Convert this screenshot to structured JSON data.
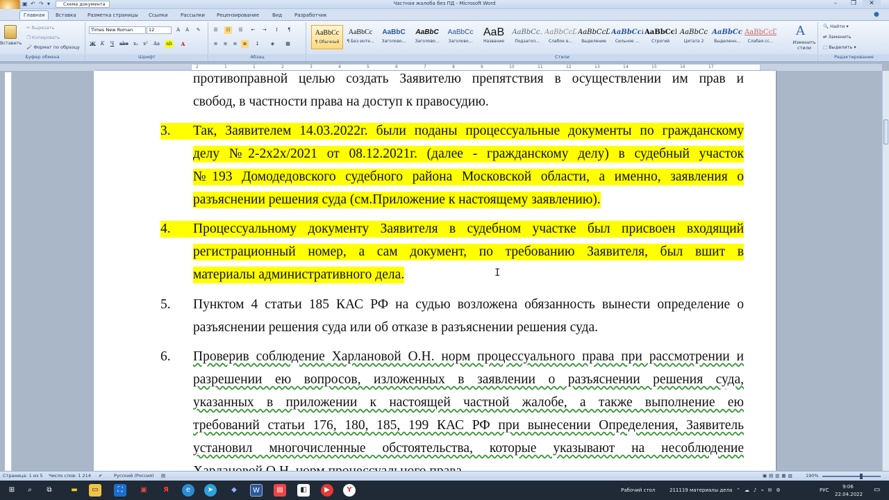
{
  "window": {
    "title": "Частная жалоба без ПД - Microsoft Word",
    "quick_access_doc": "Схема документа"
  },
  "tabs": [
    "Главная",
    "Вставка",
    "Разметка страницы",
    "Ссылки",
    "Рассылки",
    "Рецензирование",
    "Вид",
    "Разработчик"
  ],
  "ribbon": {
    "clipboard": {
      "paste": "Вставить",
      "cut": "Вырезать",
      "copy": "Копировать",
      "format_painter": "Формат по образцу",
      "label": "Буфер обмена"
    },
    "font": {
      "name": "Times New Roman",
      "size": "12",
      "label": "Шрифт"
    },
    "paragraph": {
      "label": "Абзац"
    },
    "styles": {
      "label": "Стили",
      "items": [
        {
          "sample": "AaBbCc",
          "name": "¶ Обычный"
        },
        {
          "sample": "AaBbCc",
          "name": "¶ Без инте..."
        },
        {
          "sample": "AaBbC",
          "name": "Заголово..."
        },
        {
          "sample": "AaBbC",
          "name": "Заголово..."
        },
        {
          "sample": "AaBbCc",
          "name": "Заголово..."
        },
        {
          "sample": "AaB",
          "name": "Название"
        },
        {
          "sample": "AaBbCc.",
          "name": "Подзагол..."
        },
        {
          "sample": "AaBbCcD",
          "name": "Слабое в..."
        },
        {
          "sample": "AaBbCcD",
          "name": "Выделение"
        },
        {
          "sample": "AaBbCcD",
          "name": "Сильное ..."
        },
        {
          "sample": "AaBbCcD",
          "name": "Строгий"
        },
        {
          "sample": "AaBbCc",
          "name": "Цитата 2"
        },
        {
          "sample": "AaBbCc",
          "name": "Выделенн..."
        },
        {
          "sample": "AaBbCcD",
          "name": "Слабая сс..."
        }
      ],
      "change_styles": "Изменить стили"
    },
    "editing": {
      "find": "Найти",
      "replace": "Заменить",
      "select": "Выделить",
      "label": "Редактирование"
    }
  },
  "ruler_numbers": [
    "2",
    "1",
    "1",
    "2",
    "3",
    "4",
    "5",
    "6",
    "7",
    "8",
    "9",
    "10",
    "11",
    "12",
    "13",
    "14",
    "15",
    "16",
    "17"
  ],
  "document": {
    "lines": [
      {
        "num": "",
        "text": "противоправной целью создать Заявителю препятствия в осуществлении им прав и",
        "hl": false,
        "justify": true
      },
      {
        "num": "",
        "text": "свобод, в частности права на доступ к правосудию.",
        "hl": false,
        "justify": false
      },
      {
        "num": "3.",
        "text": "Так, Заявителем 14.03.2022г. были поданы процессуальные документы по гражданскому",
        "hl": true,
        "justify": true
      },
      {
        "num": "",
        "text": "делу №2-2х2х/2021  от 08.12.2021г.  (далее - гражданскому делу) в судебный участок",
        "hl": true,
        "justify": true
      },
      {
        "num": "",
        "text": "№193 Домодедовского судебного района Московской области, а именно, заявления о",
        "hl": true,
        "justify": true
      },
      {
        "num": "",
        "text": "разъяснении решения суда (см.Приложение к настоящему заявлению).",
        "hl": true,
        "justify": false
      },
      {
        "num": "4.",
        "text": "Процессуальному документу Заявителя в судебном участке был присвоен входящий",
        "hl": true,
        "justify": true
      },
      {
        "num": "",
        "text": "регистрационный номер, а сам документ, по требованию Заявителя, был вшит в",
        "hl": true,
        "justify": true
      },
      {
        "num": "",
        "text": "материалы административного дела.",
        "hl": true,
        "justify": false
      },
      {
        "num": "5.",
        "text": "Пунктом 4 статьи 185 КАС РФ на судью возложена обязанность вынести определение о",
        "hl": false,
        "justify": true
      },
      {
        "num": "",
        "text": "разъяснении решения суда или об отказе в разъяснении решения суда.",
        "hl": false,
        "justify": false
      },
      {
        "num": "6.",
        "text": "Проверив соблюдение Харлановой О.Н.  норм процессуального права при рассмотрении и",
        "hl": false,
        "justify": true,
        "ul": true
      },
      {
        "num": "",
        "text": "разрешении ею вопросов, изложенных в заявлении о разъяснении решения суда,",
        "hl": false,
        "justify": true,
        "ul": true
      },
      {
        "num": "",
        "text": "указанных в приложении к настоящей частной жалобе, а также выполнение ею",
        "hl": false,
        "justify": true,
        "ul": true
      },
      {
        "num": "",
        "text": "требований статьи 176, 180, 185, 199 КАС РФ при вынесении Определения, Заявитель",
        "hl": false,
        "justify": true,
        "ul": true
      },
      {
        "num": "",
        "text": "установил многочисленные обстоятельства, которые указывают на несоблюдение",
        "hl": false,
        "justify": true,
        "ul": true
      },
      {
        "num": "",
        "text": "Харлановой О.Н.  норм процессуального права",
        "hl": false,
        "justify": false,
        "ul": true
      }
    ]
  },
  "statusbar": {
    "page": "Страница: 1 из 5",
    "words": "Число слов: 1 214",
    "language": "Русский (Россия)",
    "zoom": "190%"
  },
  "taskbar": {
    "desktop": "Рабочий стол",
    "folder": "211119 материалы дела",
    "lang": "РУС",
    "time": "9:06",
    "date": "22.04.2022"
  },
  "colors": {
    "highlight": "#ffff00",
    "ribbon": "#dce7f5",
    "taskbar": "#1f2a36"
  }
}
